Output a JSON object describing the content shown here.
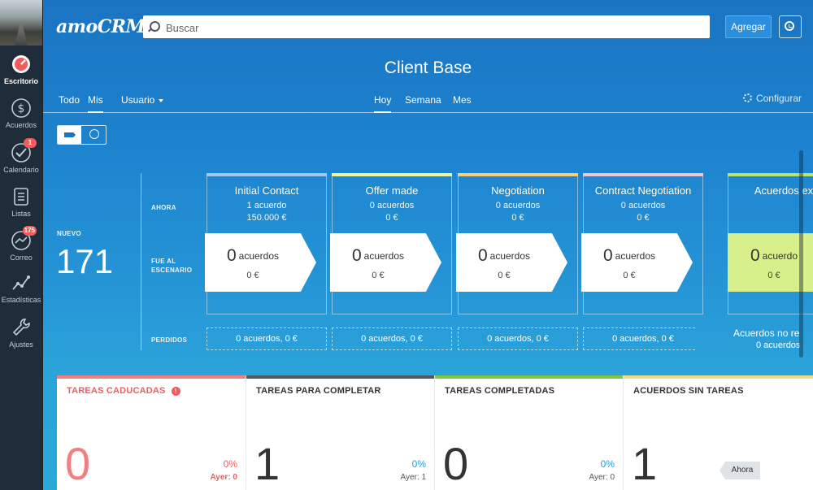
{
  "sidebar": {
    "items": [
      {
        "label": "Escritorio",
        "icon": "dashboard-icon",
        "active": true
      },
      {
        "label": "Acuerdos",
        "icon": "dollar-icon"
      },
      {
        "label": "Calendario",
        "icon": "check-icon",
        "badge": "1"
      },
      {
        "label": "Listas",
        "icon": "list-icon"
      },
      {
        "label": "Correo",
        "icon": "mail-icon",
        "badge": "175"
      },
      {
        "label": "Estadísticas",
        "icon": "stats-icon"
      },
      {
        "label": "Ajustes",
        "icon": "wrench-icon"
      }
    ]
  },
  "header": {
    "logo": "amoCRM.",
    "search_placeholder": "Buscar",
    "add_label": "Agregar",
    "title": "Client Base"
  },
  "filters": {
    "left": [
      "Todo",
      "Mis"
    ],
    "user": "Usuario",
    "period": [
      "Hoy",
      "Semana",
      "Mes"
    ],
    "configure": "Configurar"
  },
  "funnel": {
    "new_label": "NUEVO",
    "new_count": "171",
    "row_labels": {
      "now": "AHORA",
      "stage_line1": "FUE AL",
      "stage_line2": "ESCENARIO",
      "lost": "PERDIDOS"
    },
    "stages": [
      {
        "name": "Initial Contact",
        "count": "1 acuerdo",
        "amount": "150.000 €",
        "color": "#9ec8f3",
        "moved_num": "0",
        "moved_unit": "acuerdos",
        "moved_eur": "0 €",
        "lost": "0 acuerdos, 0 €"
      },
      {
        "name": "Offer made",
        "count": "0 acuerdos",
        "amount": "0 €",
        "color": "#f2f59a",
        "moved_num": "0",
        "moved_unit": "acuerdos",
        "moved_eur": "0 €",
        "lost": "0 acuerdos, 0 €"
      },
      {
        "name": "Negotiation",
        "count": "0 acuerdos",
        "amount": "0 €",
        "color": "#f7cf7b",
        "moved_num": "0",
        "moved_unit": "acuerdos",
        "moved_eur": "0 €",
        "lost": "0 acuerdos, 0 €"
      },
      {
        "name": "Contract Negotiation",
        "count": "0 acuerdos",
        "amount": "0 €",
        "color": "#f5c4d4",
        "moved_num": "0",
        "moved_unit": "acuerdos",
        "moved_eur": "0 €",
        "lost": "0 acuerdos, 0 €"
      },
      {
        "name": "Acuerdos ex",
        "color": "#b8e66b",
        "moved_num": "0",
        "moved_unit": "acuerdo",
        "moved_eur": "0 €"
      }
    ],
    "not_realized_line1": "Acuerdos no re",
    "not_realized_line2": "0 acuerdos"
  },
  "widgets": [
    {
      "title": "TAREAS CADUCADAS",
      "value": "0",
      "pct": "0%",
      "ayer": "Ayer: 0",
      "color": "#f37e7e"
    },
    {
      "title": "TAREAS PARA COMPLETAR",
      "value": "1",
      "pct": "0%",
      "ayer": "Ayer: 1",
      "color": "#505a63"
    },
    {
      "title": "TAREAS COMPLETADAS",
      "value": "0",
      "pct": "0%",
      "ayer": "Ayer: 0",
      "color": "#79c943"
    },
    {
      "title": "ACUERDOS SIN TAREAS",
      "value": "1",
      "color": "#f3d88a"
    }
  ],
  "ahora_tag": "Ahora"
}
